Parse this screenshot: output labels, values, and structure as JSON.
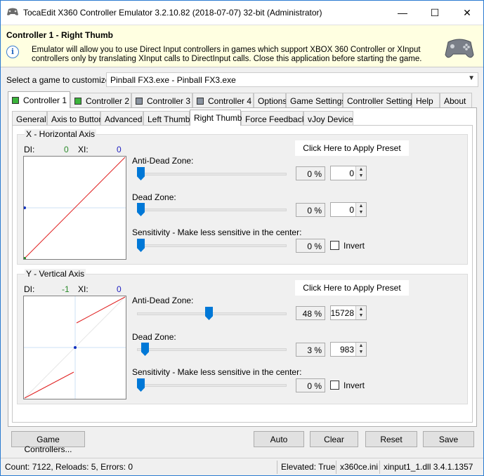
{
  "window": {
    "title": "TocaEdit X360 Controller Emulator 3.2.10.82 (2018-07-07) 32-bit (Administrator)",
    "minimize": "—",
    "maximize": "☐",
    "close": "✕"
  },
  "header": {
    "title": "Controller 1 - Right Thumb",
    "info_icon": "i",
    "text": "Emulator will allow you to use Direct Input controllers in games which support XBOX 360 Controller or XInput controllers only by translating XInput calls to DirectInput calls. Close this application before starting the game."
  },
  "game_select": {
    "label": "Select a game to customize:",
    "value": "Pinball FX3.exe - Pinball FX3.exe"
  },
  "main_tabs": [
    {
      "label": "Controller 1",
      "icon": "green-square-icon"
    },
    {
      "label": "Controller 2",
      "icon": "green-square-icon"
    },
    {
      "label": "Controller 3",
      "icon": "gray-square-icon"
    },
    {
      "label": "Controller 4",
      "icon": "gray-square-icon"
    },
    {
      "label": "Options"
    },
    {
      "label": "Game Settings"
    },
    {
      "label": "Controller Settings"
    },
    {
      "label": "Help"
    },
    {
      "label": "About"
    }
  ],
  "sub_tabs": [
    "General",
    "Axis to Button",
    "Advanced",
    "Left Thumb",
    "Right Thumb",
    "Force Feedback",
    "vJoy Device"
  ],
  "x_axis": {
    "title": "X - Horizontal Axis",
    "di_label": "DI:",
    "di_value": "0",
    "xi_label": "XI:",
    "xi_value": "0",
    "preset": "Click Here to Apply Preset",
    "anti_dead_label": "Anti-Dead Zone:",
    "anti_dead_pct": "0 %",
    "anti_dead_value": "0",
    "anti_dead_level": 0,
    "dead_label": "Dead Zone:",
    "dead_pct": "0 %",
    "dead_value": "0",
    "dead_level": 0,
    "sens_label": "Sensitivity - Make less sensitive in the center:",
    "sens_pct": "0 %",
    "sens_level": 0,
    "invert": "Invert"
  },
  "y_axis": {
    "title": "Y - Vertical Axis",
    "di_label": "DI:",
    "di_value": "-1",
    "xi_label": "XI:",
    "xi_value": "0",
    "preset": "Click Here to Apply Preset",
    "anti_dead_label": "Anti-Dead Zone:",
    "anti_dead_pct": "48 %",
    "anti_dead_value": "15728",
    "anti_dead_level": 48,
    "dead_label": "Dead Zone:",
    "dead_pct": "3 %",
    "dead_value": "983",
    "dead_level": 3,
    "sens_label": "Sensitivity - Make less sensitive in the center:",
    "sens_pct": "0 %",
    "sens_level": 0,
    "invert": "Invert"
  },
  "buttons": {
    "game_controllers": "Game Controllers...",
    "auto": "Auto",
    "clear": "Clear",
    "reset": "Reset",
    "save": "Save"
  },
  "status": {
    "counts": "Count: 7122, Reloads: 5, Errors: 0",
    "elevated": "Elevated: True",
    "ini": "x360ce.ini",
    "dll": "xinput1_1.dll 3.4.1.1357"
  },
  "colors": {
    "di_value": "#2a8a2a",
    "xi_value": "#2020c0",
    "curve": "#e02020",
    "accent": "#0078d7"
  }
}
